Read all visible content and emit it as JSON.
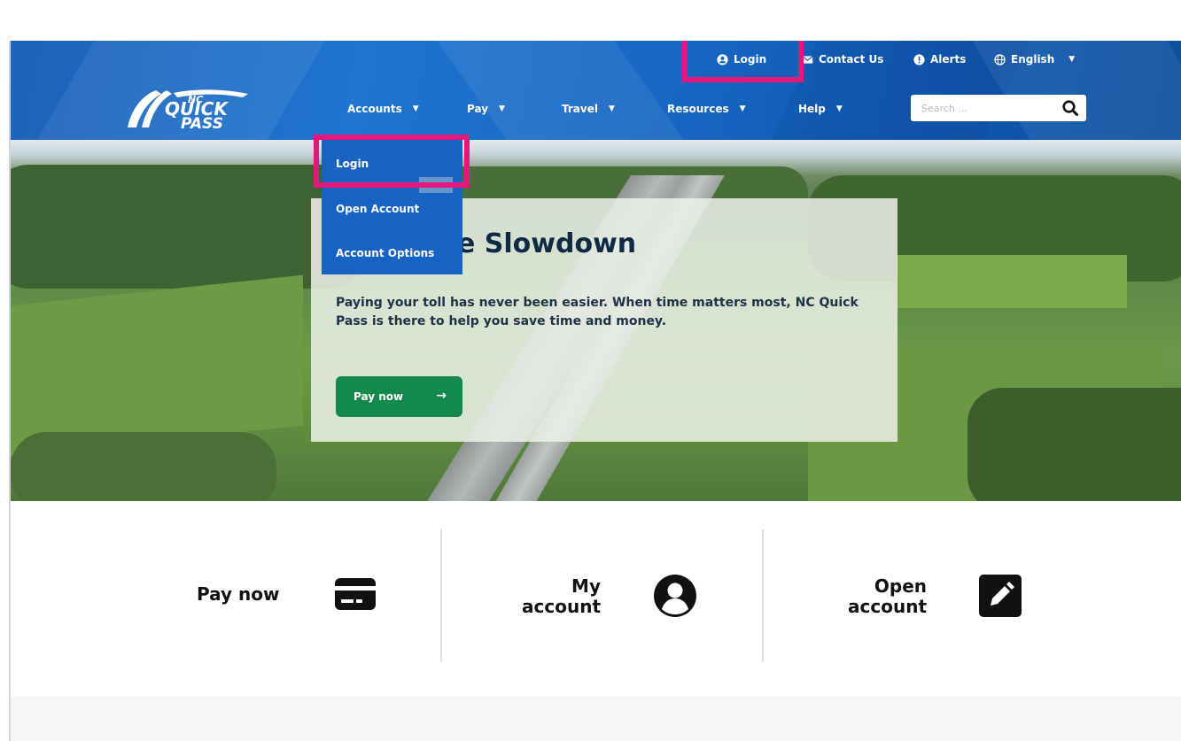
{
  "colors": {
    "header_blue": "#1767c3",
    "dropdown_blue": "#1663c4",
    "highlight_pink": "#e6177c",
    "pay_green": "#138a4c",
    "text_dark": "#111111"
  },
  "utility_nav": {
    "login": {
      "label": "Login",
      "icon": "user-circle-icon"
    },
    "contact": {
      "label": "Contact Us",
      "icon": "envelope-icon"
    },
    "alerts": {
      "label": "Alerts",
      "icon": "alert-icon"
    },
    "language": {
      "label": "English",
      "icon": "globe-icon"
    }
  },
  "logo": {
    "line1": "NC",
    "line2": "QUICK",
    "line3": "PASS"
  },
  "main_nav": {
    "accounts": "Accounts",
    "pay": "Pay",
    "travel": "Travel",
    "resources": "Resources",
    "help": "Help"
  },
  "search": {
    "placeholder": "Search ..."
  },
  "accounts_menu": {
    "items": [
      "Login",
      "Open Account",
      "Account Options"
    ]
  },
  "hero": {
    "title": "Skip the Slowdown",
    "title_visible": "e Slowdown",
    "text": "Paying your toll has never been easier. When time matters most, NC Quick Pass is there to help you save time and money.",
    "button": "Pay now"
  },
  "quick_links": {
    "pay_now": {
      "label": "Pay now",
      "icon": "credit-card-icon"
    },
    "my_account": {
      "line1": "My",
      "line2": "account",
      "icon": "user-circle-icon"
    },
    "open_account": {
      "line1": "Open",
      "line2": "account",
      "icon": "edit-icon"
    }
  }
}
